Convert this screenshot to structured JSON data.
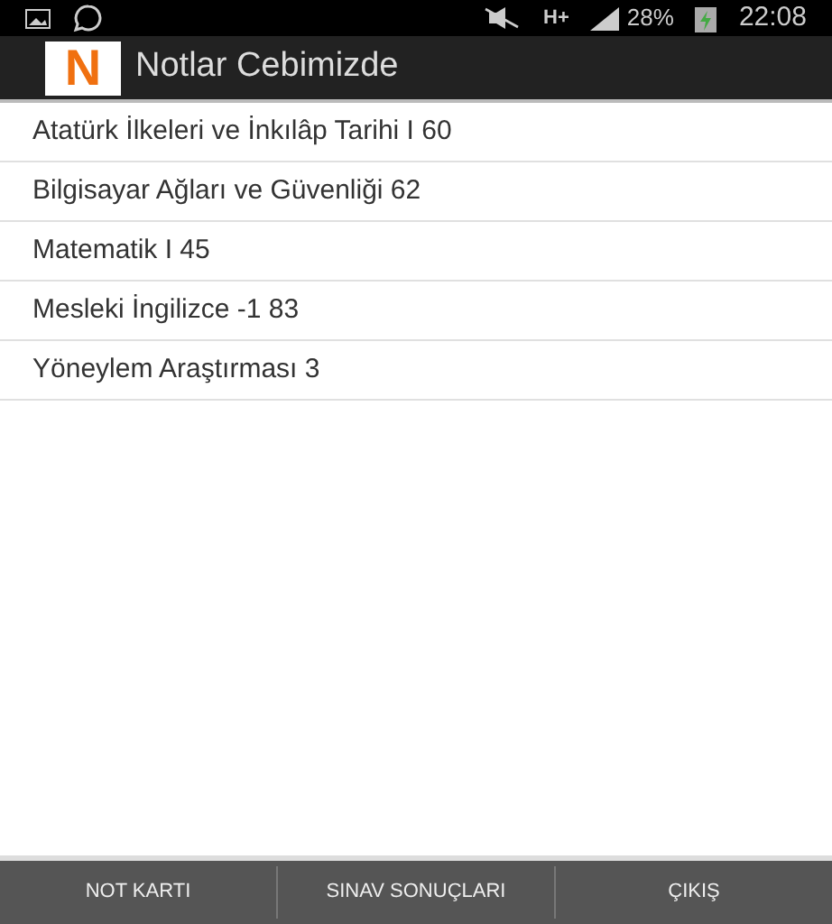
{
  "status_bar": {
    "network": "H+",
    "battery": "28%",
    "time": "22:08"
  },
  "action_bar": {
    "logo": "N",
    "title": "Notlar Cebimizde"
  },
  "items": [
    "Atatürk İlkeleri ve İnkılâp Tarihi I 60",
    "Bilgisayar Ağları ve Güvenliği 62",
    "Matematik I 45",
    "Mesleki İngilizce -1 83",
    "Yöneylem Araştırması 3"
  ],
  "bottom_tabs": [
    "NOT KARTI",
    "SINAV SONUÇLARI",
    "ÇIKIŞ"
  ]
}
